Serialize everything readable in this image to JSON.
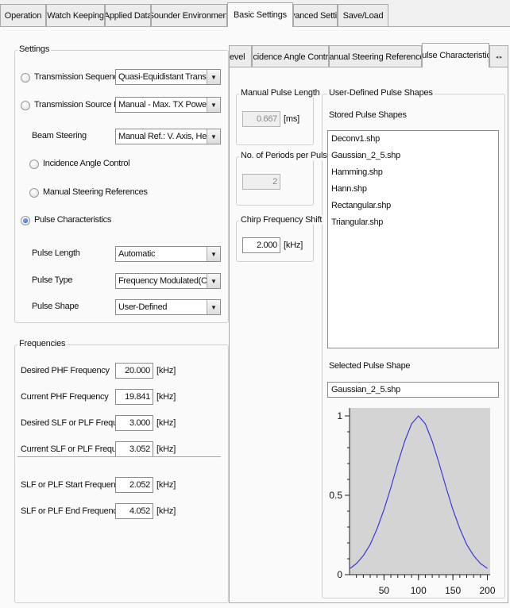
{
  "top_tabs": [
    "Operation",
    "Watch Keeping",
    "Applied Data",
    "Sounder Environment",
    "Basic Settings",
    "Advanced Settings",
    "Save/Load"
  ],
  "sub_tabs": [
    "evel",
    "Incidence Angle Control",
    "Manual Steering References",
    "Pulse Characteristics"
  ],
  "sub_tab_scroll": "◂ ▸",
  "settings": {
    "title": "Settings",
    "transmission_sequence": {
      "label": "Transmission Sequence",
      "value": "Quasi-Equidistant Transmission"
    },
    "transmission_source_level": {
      "label": "Transmission Source Level",
      "value": "Manual - Max. TX Power"
    },
    "beam_steering": {
      "label": "Beam Steering",
      "value": "Manual Ref.: V. Axis, Heading"
    },
    "incidence_angle_control": "Incidence Angle Control",
    "manual_steering_references": "Manual Steering References",
    "pulse_characteristics": "Pulse Characteristics",
    "pulse_length": {
      "label": "Pulse Length",
      "value": "Automatic"
    },
    "pulse_type": {
      "label": "Pulse Type",
      "value": "Frequency Modulated(Chirped)"
    },
    "pulse_shape": {
      "label": "Pulse Shape",
      "value": "User-Defined"
    }
  },
  "frequencies": {
    "title": "Frequencies",
    "rows": [
      {
        "label": "Desired PHF Frequency",
        "value": "20.000",
        "unit": "[kHz]"
      },
      {
        "label": "Current PHF Frequency",
        "value": "19.841",
        "unit": "[kHz]"
      },
      {
        "label": "Desired SLF or PLF Frequency",
        "value": "3.000",
        "unit": "[kHz]"
      },
      {
        "label": "Current SLF or PLF Frequency",
        "value": "3.052",
        "unit": "[kHz]"
      },
      {
        "label": "SLF or PLF Start Frequency",
        "value": "2.052",
        "unit": "[kHz]"
      },
      {
        "label": "SLF or PLF End Frequency",
        "value": "4.052",
        "unit": "[kHz]"
      }
    ]
  },
  "manual_pulse_length": {
    "title": "Manual Pulse Length",
    "value": "0.667",
    "unit": "[ms]"
  },
  "periods_per_pulse": {
    "title": "No. of Periods per Pulse",
    "value": "2"
  },
  "chirp_frequency_shift": {
    "title": "Chirp Frequency Shift",
    "value": "2.000",
    "unit": "[kHz]"
  },
  "user_defined": {
    "title": "User-Defined Pulse Shapes",
    "stored_label": "Stored Pulse Shapes",
    "stored_shapes": [
      "Deconv1.shp",
      "Gaussian_2_5.shp",
      "Hamming.shp",
      "Hann.shp",
      "Rectangular.shp",
      "Triangular.shp"
    ],
    "selected_label": "Selected Pulse Shape",
    "selected_value": "Gaussian_2_5.shp"
  },
  "colors": {
    "curve": "#3a3adb",
    "plot_bg": "#d4d4d4",
    "radio_selected": "#1f5fb4"
  },
  "chart_data": {
    "type": "line",
    "title": "",
    "xlabel": "",
    "ylabel": "",
    "xlim": [
      0,
      204
    ],
    "ylim": [
      0,
      1.05
    ],
    "x_ticks": [
      50,
      100,
      150,
      200
    ],
    "x_tick_labels": [
      "50",
      "100",
      "150",
      "200"
    ],
    "y_ticks": [
      0,
      0.5,
      1
    ],
    "y_tick_labels": [
      "0",
      "0.5",
      "1"
    ],
    "grid": false,
    "series": [
      {
        "x": [
          1,
          10,
          20,
          30,
          40,
          50,
          60,
          70,
          80,
          90,
          100,
          110,
          120,
          130,
          140,
          150,
          160,
          170,
          180,
          190,
          200
        ],
        "y": [
          0.04,
          0.07,
          0.12,
          0.19,
          0.29,
          0.41,
          0.55,
          0.7,
          0.84,
          0.95,
          1.0,
          0.95,
          0.84,
          0.7,
          0.55,
          0.41,
          0.29,
          0.19,
          0.12,
          0.07,
          0.04
        ]
      }
    ]
  }
}
